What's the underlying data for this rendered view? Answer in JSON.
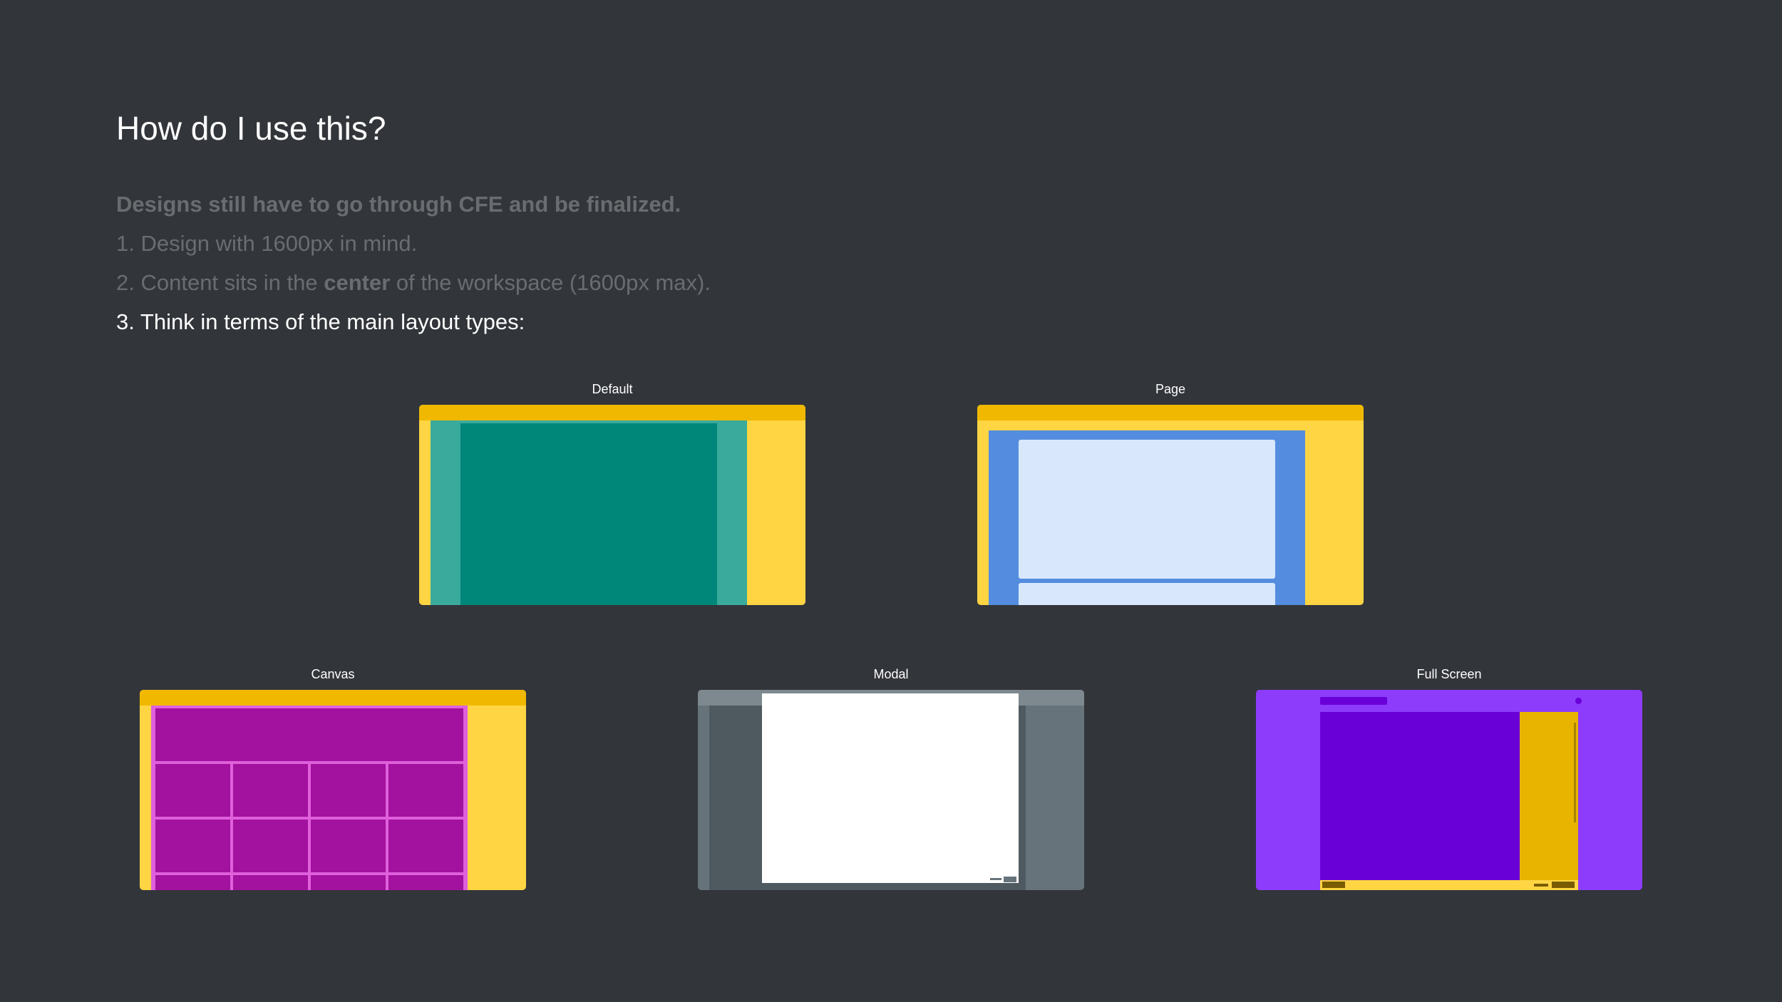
{
  "title": "How do I use this?",
  "lines": {
    "note": "Designs still have to go through CFE and be finalized.",
    "step1": "1. Design with 1600px in mind.",
    "step2_prefix": "2. Content sits in the ",
    "step2_bold": "center",
    "step2_suffix": " of the workspace (1600px max).",
    "step3": "3. Think in terms of the main layout types:"
  },
  "layouts": {
    "default": "Default",
    "page": "Page",
    "canvas": "Canvas",
    "modal": "Modal",
    "fullscreen": "Full Screen"
  },
  "colors": {
    "background": "#32353a",
    "shell_yellow": "#ffd543",
    "shell_bar": "#f0b800",
    "teal": "#00877a",
    "teal_light": "#3aaa9c",
    "blue": "#548ddf",
    "blue_light": "#d9e7fd",
    "magenta": "#a2129e",
    "magenta_line": "#e060dc",
    "modal_grey": "#67737a",
    "purple": "#8c3cfa",
    "purple_dark": "#6a00d8"
  }
}
